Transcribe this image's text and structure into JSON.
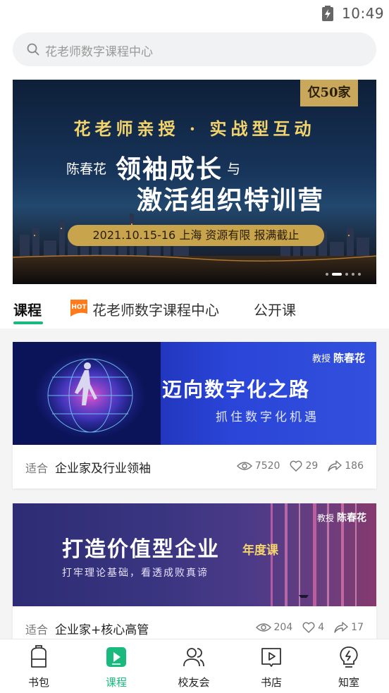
{
  "status": {
    "time": "10:49"
  },
  "search": {
    "placeholder": "花老师数字课程中心"
  },
  "banner": {
    "badge": "仅50家",
    "line1": "花老师亲授 · 实战型互动",
    "teacher": "陈春花",
    "title_a": "领袖成长",
    "yu": "与",
    "title_b": "激活组织特训营",
    "pill": "2021.10.15-16 上海 资源有限 报满截止"
  },
  "tabs": [
    {
      "label": "课程",
      "active": true
    },
    {
      "label": "花老师数字课程中心",
      "badge": "HOT"
    },
    {
      "label": "公开课"
    }
  ],
  "courses": [
    {
      "prof_label": "教授",
      "prof_name": "陈春花",
      "title": "迈向数字化之路",
      "subtitle": "抓住数字化机遇",
      "fit_label": "适合",
      "fit_value": "企业家及行业领袖",
      "views": "7520",
      "likes": "29",
      "shares": "186"
    },
    {
      "prof_label": "教授",
      "prof_name": "陈春花",
      "title": "打造价值型企业",
      "tag": "年度课",
      "subtitle": "打牢理论基础，看透成败真谛",
      "fit_label": "适合",
      "fit_value": "企业家+核心高管",
      "views": "204",
      "likes": "4",
      "shares": "17"
    }
  ],
  "nav": [
    {
      "label": "书包",
      "icon": "backpack-icon"
    },
    {
      "label": "课程",
      "icon": "play-icon",
      "active": true
    },
    {
      "label": "校友会",
      "icon": "people-icon"
    },
    {
      "label": "书店",
      "icon": "book-icon"
    },
    {
      "label": "知室",
      "icon": "lightbulb-icon"
    }
  ],
  "colors": {
    "accent": "#1aba7e",
    "gold": "#c9a85b",
    "hot": "#ff7a1a"
  }
}
